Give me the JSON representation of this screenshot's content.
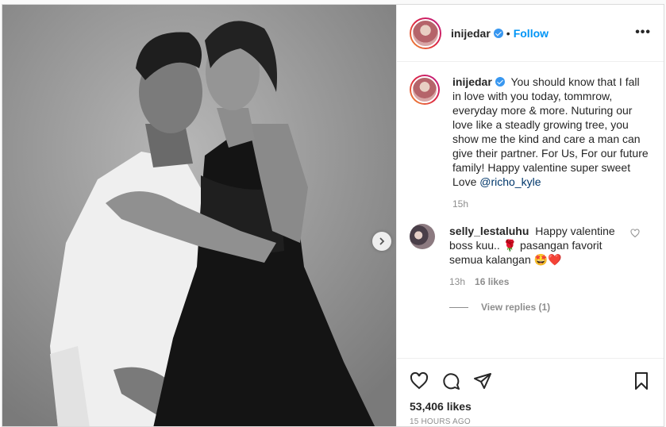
{
  "post": {
    "author": "inijedar",
    "follow_label": "Follow",
    "separator": "•",
    "more_label": "•••"
  },
  "caption": {
    "username": "inijedar",
    "text": "You should know that I fall in love with you today, tommrow, everyday more & more. Nuturing our love like a steadly growing tree, you show me the kind and care a man can give their partner. For Us, For our future family! Happy valentine super sweet Love",
    "mention": "@richo_kyle",
    "time": "15h"
  },
  "comment": {
    "username": "selly_lestaluhu",
    "text": "Happy valentine boss kuu.. 🌹 pasangan favorit semua kalangan 🤩❤️",
    "time": "13h",
    "likes": "16 likes",
    "view_replies": "View replies (1)"
  },
  "footer": {
    "likes": "53,406 likes",
    "posted_ago": "15 HOURS AGO"
  },
  "colors": {
    "accent": "#0095f6",
    "verified": "#3897f0",
    "muted": "#8e8e8e"
  }
}
